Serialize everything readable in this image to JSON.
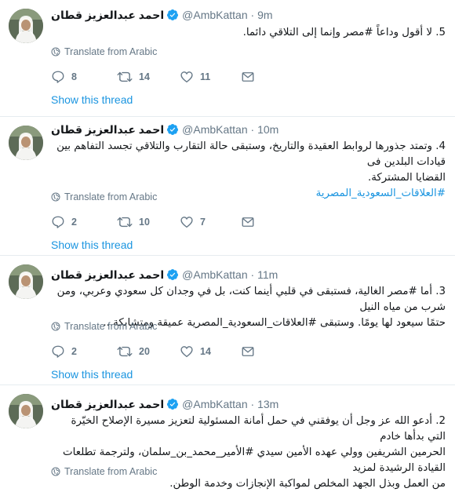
{
  "tweets": [
    {
      "name": "احمد عبدالعزيز قطان",
      "handle": "@AmbKattan",
      "time": "9m",
      "lines": [
        "5.  لا أقول وداعاً #مصر وإنما إلى التلاقي دائما."
      ],
      "translate": "Translate from Arabic",
      "replies": "8",
      "retweets": "14",
      "likes": "11",
      "show_thread": "Show this thread"
    },
    {
      "name": "احمد عبدالعزيز قطان",
      "handle": "@AmbKattan",
      "time": "10m",
      "lines": [
        "4. وتمتد جذورها لروابط العقيدة والتاريخ، وستبقى حالة التقارب والتلاقي تجسد التفاهم بين  قيادات البلدين فى",
        "القضايا المشتركة.",
        "#العلاقات_السعودية_المصرية"
      ],
      "translate": "Translate from Arabic",
      "replies": "2",
      "retweets": "10",
      "likes": "7",
      "show_thread": "Show this thread"
    },
    {
      "name": "احمد عبدالعزيز قطان",
      "handle": "@AmbKattan",
      "time": "11m",
      "lines": [
        "3.  أما #مصر الغالية، فستبقى في قلبي أينما كنت، بل في وجدان كل سعودي وعربي، ومن شرب من مياه النيل",
        "حتمًا سيعود لها يومًا. وستبقى #العلاقات_السعودية_المصرية عميقة ومتشابكة..."
      ],
      "translate": "Translate from Arabic",
      "replies": "2",
      "retweets": "20",
      "likes": "14",
      "show_thread": "Show this thread"
    },
    {
      "name": "احمد عبدالعزيز قطان",
      "handle": "@AmbKattan",
      "time": "13m",
      "lines": [
        "2.  أدعو الله عز وجل أن يوفقني في حمل أمانة المسئولية  لتعزيز مسيرة الإصلاح الخيّرة التي بدأها خادم",
        "الحرمين الشريفين وولي عهده  الأمين سيدي #الأمير_محمد_بن_سلمان، ولترجمة تطلعات القيادة الرشيدة لمزيد",
        "من العمل وبذل الجهد المخلص لمواكبة الإنجازات وخدمة الوطن."
      ],
      "translate": "Translate from Arabic"
    }
  ],
  "colors": {
    "link": "#1b95e0",
    "muted": "#657786",
    "verified": "#1da1f2"
  },
  "icons": [
    "avatar",
    "verified-icon",
    "globe-icon",
    "reply-icon",
    "retweet-icon",
    "like-icon",
    "message-icon"
  ]
}
